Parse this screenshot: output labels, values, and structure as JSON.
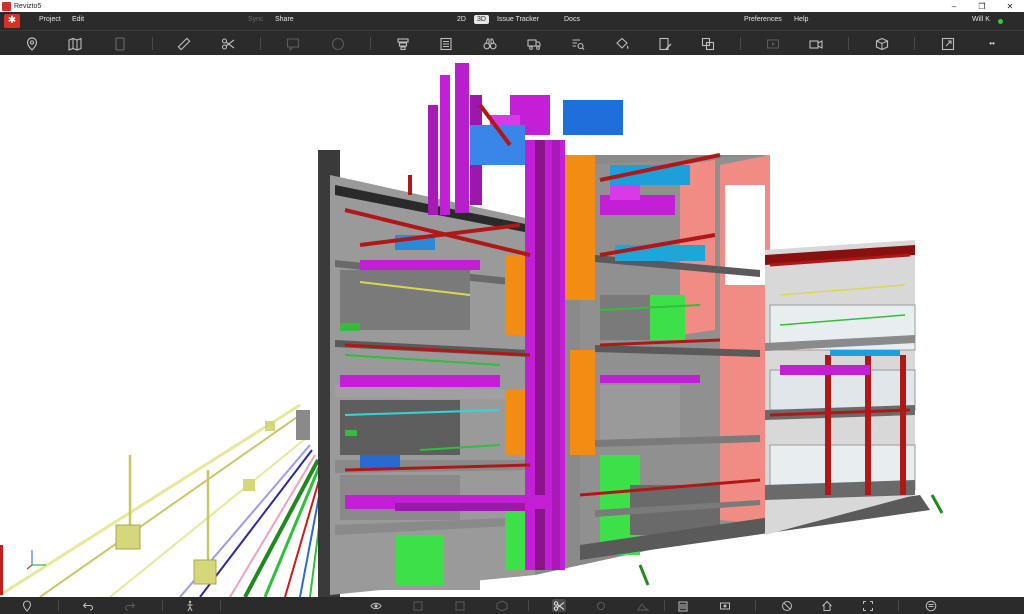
{
  "window": {
    "title": "Revizto5",
    "minimize": "–",
    "restore": "❐",
    "close": "✕"
  },
  "menu": {
    "project": "Project",
    "edit": "Edit",
    "sync": "Sync",
    "share": "Share",
    "mode_2d": "2D",
    "mode_3d": "3D",
    "issue_tracker": "Issue Tracker",
    "docs": "Docs",
    "preferences": "Preferences",
    "help": "Help",
    "user": "Will K"
  },
  "toolbar": {
    "icons": [
      "location-pin-icon",
      "map-pin-icon",
      "tablet-icon",
      "ruler-icon",
      "scissors-icon",
      "add-comment-icon",
      "speech-icon",
      "layers-icon",
      "list-icon",
      "binoculars-icon",
      "truck-icon",
      "search-filter-icon",
      "paint-bucket-icon",
      "edit-document-icon",
      "clash-icon",
      "video-icon",
      "camera-icon",
      "cube-add-icon",
      "expand-icon",
      "more-icon"
    ],
    "more": "••"
  },
  "bottombar": {
    "icons": [
      "location-icon",
      "undo-icon",
      "redo-icon",
      "walk-icon",
      "eye-icon",
      "hide-icon",
      "visibility-icon",
      "section-box-icon",
      "scissors-icon",
      "settings-icon",
      "building-icon",
      "view-icon",
      "clash-icon",
      "home-icon",
      "fit-icon",
      "layers-icon"
    ]
  },
  "colors": {
    "chrome": "#2b2b2b",
    "accent_red": "#d93025",
    "status_green": "#2ecc40",
    "duct_magenta": "#c21fd6",
    "duct_blue": "#1e6fd9",
    "wall_orange": "#f28c12",
    "wall_pink": "#f08c84",
    "green_zone": "#3ee04a",
    "pipe_red": "#b01818"
  }
}
